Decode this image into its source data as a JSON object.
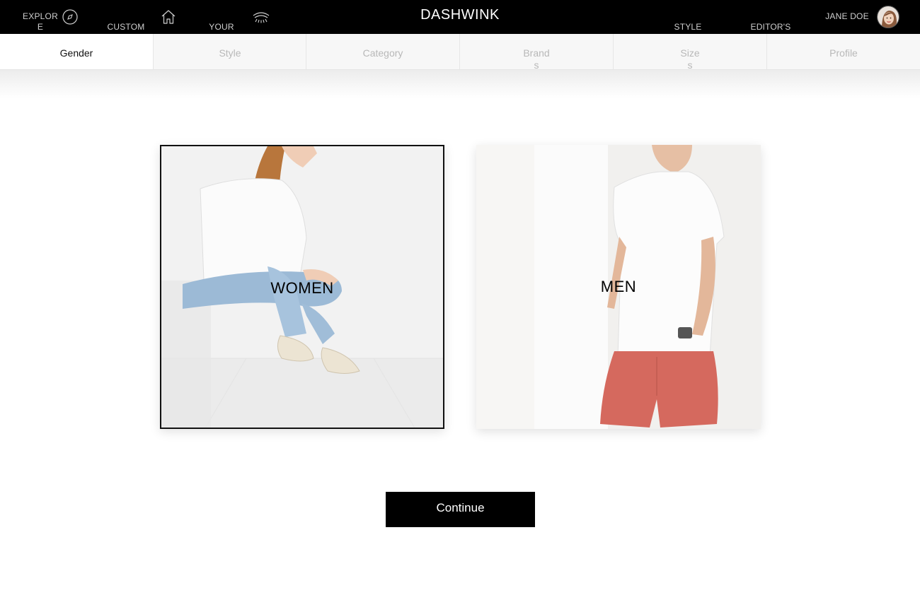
{
  "nav": {
    "explore": "EXPLORE",
    "custom_shop": "CUSTOM\nSHOP",
    "your_winks": "YOUR\nWINKS",
    "brand": "DASHWINK",
    "style_game": "STYLE\nGAME",
    "editors_blog": "EDITOR'S\nBLOG",
    "user_name": "JANE DOE"
  },
  "tabs": [
    {
      "label": "Gender",
      "active": true
    },
    {
      "label": "Style",
      "active": false
    },
    {
      "label": "Category",
      "active": false
    },
    {
      "label": "Brands",
      "active": false
    },
    {
      "label": "Sizes",
      "active": false
    },
    {
      "label": "Profile",
      "active": false
    }
  ],
  "cards": {
    "women": {
      "label": "WOMEN",
      "selected": true
    },
    "men": {
      "label": "MEN",
      "selected": false
    }
  },
  "continue_label": "Continue",
  "icons": {
    "explore": "compass-icon",
    "custom_shop": "home-icon",
    "your_winks": "eye-wink-icon"
  },
  "colors": {
    "topbar": "#000000",
    "tab_inactive_bg": "#f7f7f7",
    "tab_inactive_text": "#b8b8b8",
    "accent": "#000000"
  }
}
